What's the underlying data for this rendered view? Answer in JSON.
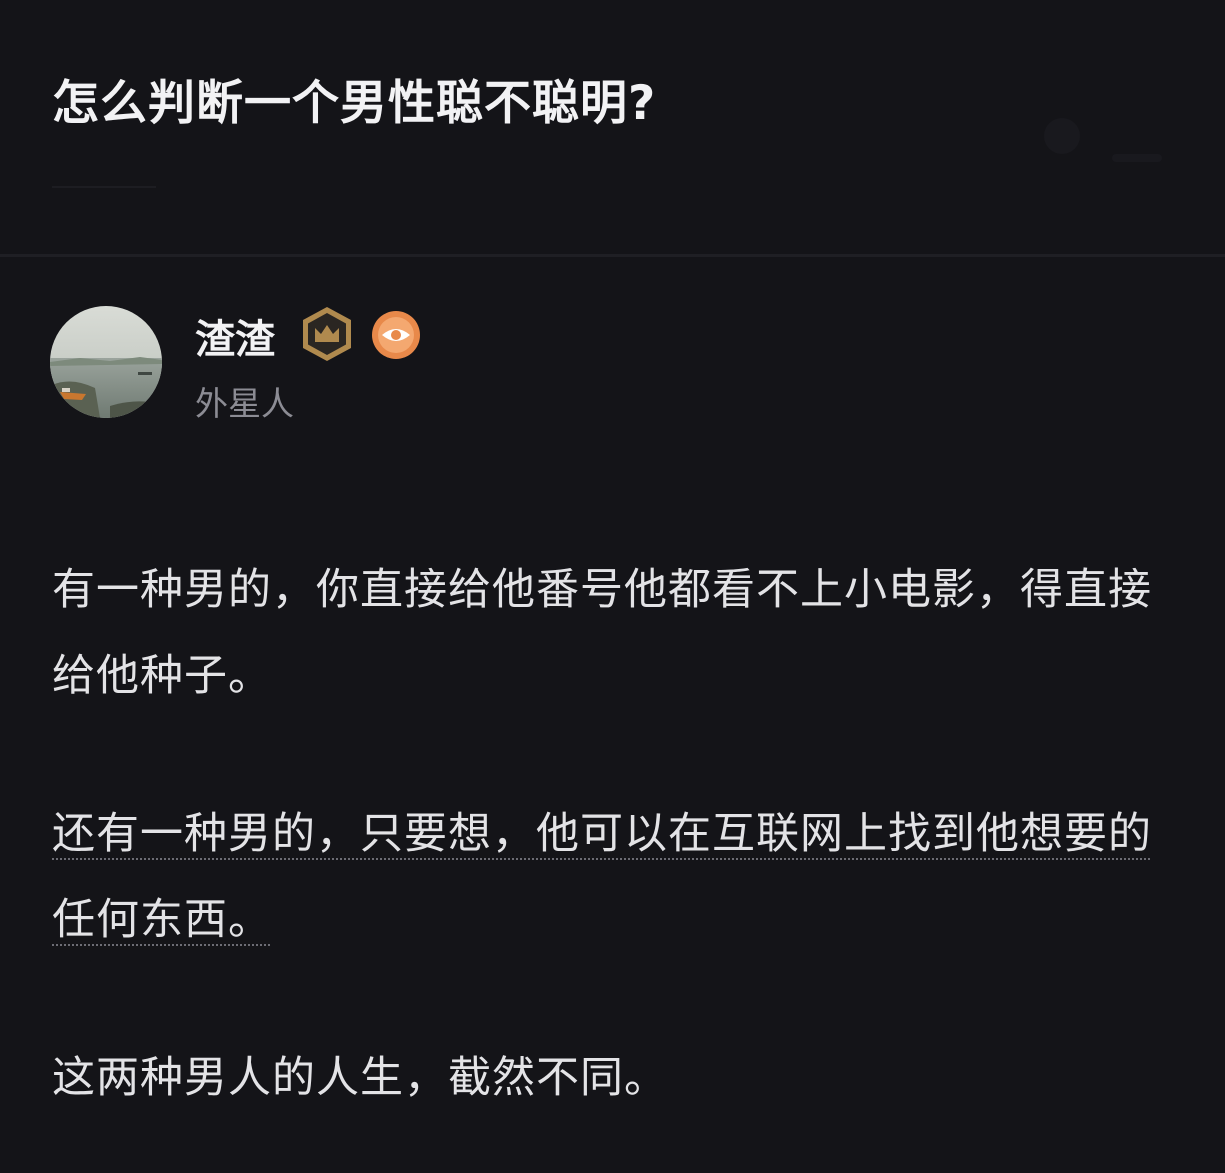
{
  "question": {
    "title": "怎么判断一个男性聪不聪明?"
  },
  "author": {
    "name": "渣渣",
    "title": "外星人",
    "badges": [
      "crown-badge-icon",
      "eye-badge-icon"
    ]
  },
  "answer": {
    "paragraphs": [
      "有一种男的，你直接给他番号他都看不上小电影，得直接给他种子。",
      "还有一种男的，只要想，他可以在互联网上找到他想要的任何东西。",
      "这两种男人的人生，截然不同。"
    ]
  },
  "colors": {
    "background": "#141418",
    "text_primary": "#f2f2f4",
    "text_secondary": "#8c8c94",
    "badge_crown": "#b08a4e",
    "badge_eye": "#e8894a"
  }
}
